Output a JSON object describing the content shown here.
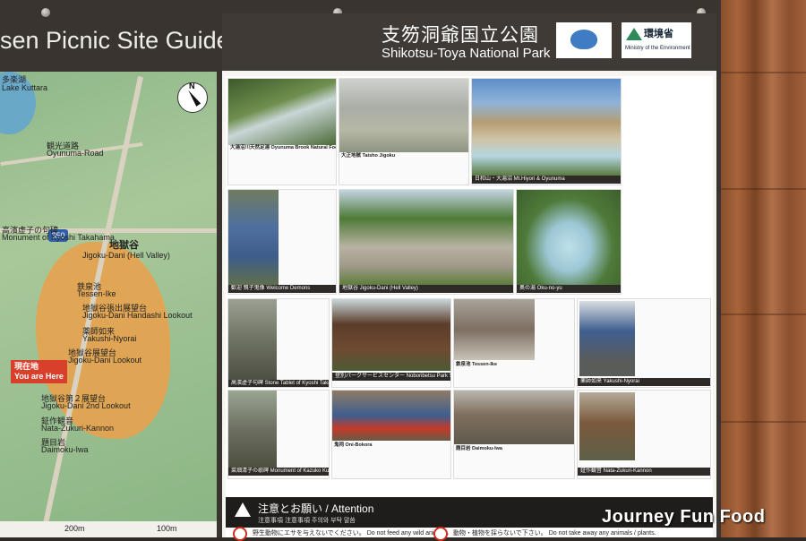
{
  "map": {
    "title": "sen Picnic Site Guide Map",
    "labels": {
      "lake_kuttara": "多楽湖",
      "lake_kuttara_en": "Lake Kuttara",
      "kanko_dori": "観光道路",
      "oyunuma_road": "Oyunuma-Road",
      "route_number": "350",
      "monument": "高濱虚子の句碑",
      "monument_en": "Monument of Kyoshi Takahama",
      "jigokudani": "地獄谷",
      "jigokudani_en": "Jigoku-Dani (Hell Valley)",
      "tessen_ike": "鉄泉池",
      "tessen_ike_en": "Tessen-Ike",
      "handashi": "地獄谷張出展望台",
      "handashi_en": "Jigoku-Dani Handashi Lookout",
      "yakushi": "薬師如来",
      "yakushi_en": "Yakushi-Nyorai",
      "lookout": "地獄谷展望台",
      "lookout_en": "Jigoku-Dani Lookout",
      "second_lookout": "地獄谷第２展望台",
      "second_lookout_en": "Jigoku-Dani 2nd Lookout",
      "kannon": "鉦作観音",
      "kannon_en": "Nata-Zukuri-Kannon",
      "daimoku": "題目岩",
      "daimoku_en": "Daimoku-Iwa",
      "you_are_here": "現在地",
      "you_are_here_en": "You are Here",
      "compass": "N"
    },
    "scale": [
      "200m",
      "100m"
    ]
  },
  "panel": {
    "title_jp": "支笏洞爺国立公園",
    "title_en": "Shikotsu-Toya National Park",
    "ministry_jp": "環境省",
    "ministry_en": "Ministry of the Environment",
    "photos": [
      {
        "caption": "大湯沼川天然足湯  Oyunuma Brook Natural Footbath"
      },
      {
        "caption": "大正地獄  Taisho Jigoku"
      },
      {
        "caption": "日和山・大湯沼  Mt.Hiyori & Oyunuma"
      },
      {
        "caption": "歓迎 親子鬼像  Welcome Demons"
      },
      {
        "caption": "地獄谷  Jigoku-Dani (Hell Valley)"
      },
      {
        "caption": "奥の湯  Oku-no-yu"
      },
      {
        "caption": "高濱虚子句碑  Stone Tablet of Kyoshi Takahama"
      },
      {
        "caption": "登別パークサービスセンター  Noboribetsu Park Service Center"
      },
      {
        "caption": "鉄泉池  Tessen-Ike"
      },
      {
        "caption": "薬師如来  Yakushi-Nyorai"
      },
      {
        "caption": "鬼祠  Oni-Bokora"
      },
      {
        "caption": "題目岩  Daimoku-Iwa"
      },
      {
        "caption": "鉦作観音  Nata-Zukuri-Kannon"
      },
      {
        "caption": "菜畑清子の歌碑  Monument of Kazuko Kurihayashi"
      }
    ],
    "attention_jp": "注意とお願い",
    "attention_en": "/ Attention",
    "attention_sub": "注意事項  注意事項  주의와 부탁 말씀",
    "rule_left": "野生動物にエサを与えないでください。 Do not feed any wild animals.",
    "rule_right": "動物・植物を採らないで下さい。 Do not take away any animals / plants."
  },
  "watermark": "Journey Fun Food"
}
